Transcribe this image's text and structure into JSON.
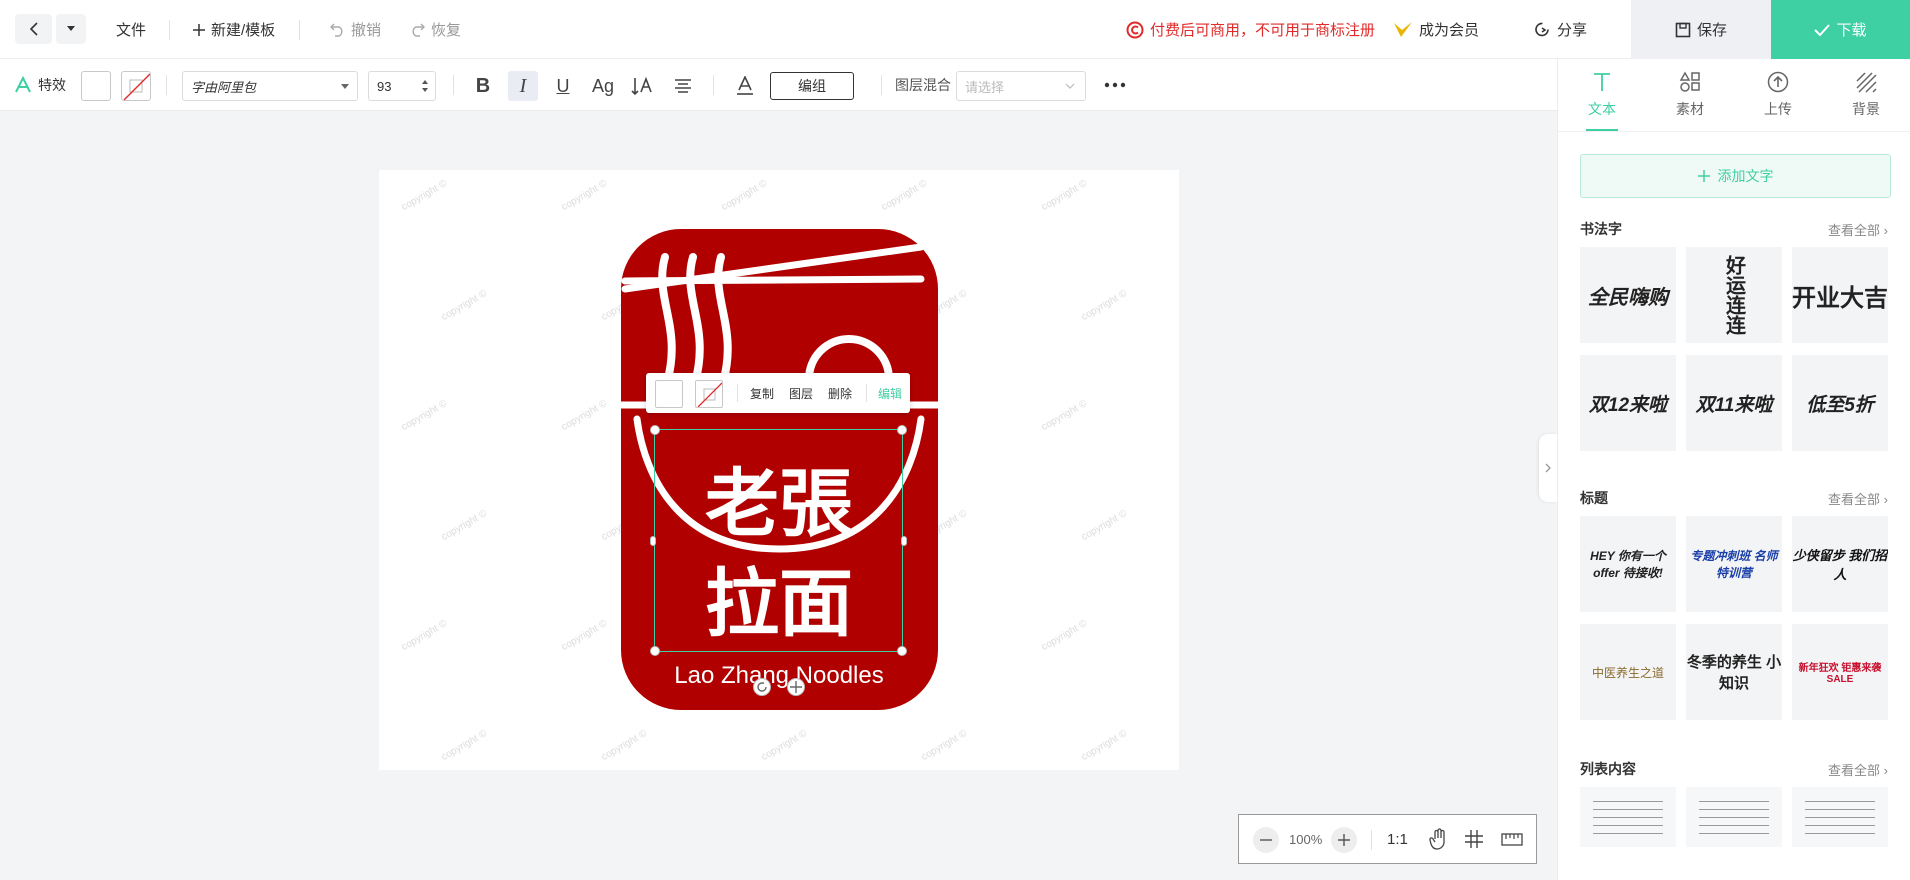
{
  "topbar": {
    "file": "文件",
    "new_template": "新建/模板",
    "undo": "撤销",
    "redo": "恢复",
    "license_notice": "付费后可商用，不可用于商标注册",
    "membership": "成为会员",
    "share": "分享",
    "save": "保存",
    "download": "下载"
  },
  "toolbar": {
    "effects": "特效",
    "font_name": "字由阿里包",
    "font_size": "93",
    "group": "编组",
    "blend_label": "图层混合",
    "blend_placeholder": "请选择"
  },
  "canvas": {
    "watermark": "copyright ©",
    "logo_text_top": "老張",
    "logo_text_bottom": "拉面",
    "logo_subtitle": "Lao Zhang Noodles",
    "logo_color": "#b00000"
  },
  "context_menu": {
    "copy": "复制",
    "layer": "图层",
    "delete": "删除",
    "edit": "编辑"
  },
  "zoom": {
    "level": "100%",
    "ratio": "1:1"
  },
  "panel": {
    "tabs": [
      {
        "label": "文本"
      },
      {
        "label": "素材"
      },
      {
        "label": "上传"
      },
      {
        "label": "背景"
      }
    ],
    "add_text": "添加文字",
    "view_all": "查看全部",
    "sections": [
      {
        "title": "书法字",
        "items": [
          "全民嗨购",
          "好运连连",
          "开业大吉",
          "双12来啦",
          "双11来啦",
          "低至5折"
        ]
      },
      {
        "title": "标题",
        "items": [
          "HEY 你有一个offer 待接收!",
          "专题冲刺班 名师特训营",
          "少侠留步 我们招人",
          "中医养生之道",
          "冬季的养生 小知识",
          "新年狂欢 钜惠来袭 SALE"
        ]
      },
      {
        "title": "列表内容",
        "items": []
      }
    ]
  },
  "colors": {
    "accent": "#3ecfa2",
    "warning": "#e22a2a",
    "membership": "#e8b600"
  }
}
